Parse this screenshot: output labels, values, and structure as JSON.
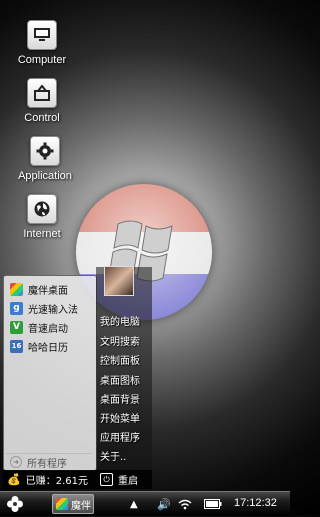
{
  "desktop": {
    "icons": [
      {
        "label": "Computer"
      },
      {
        "label": "Control"
      },
      {
        "label": "Application"
      },
      {
        "label": "Internet"
      }
    ]
  },
  "start_menu": {
    "apps": [
      {
        "label": "魔伴桌面"
      },
      {
        "label": "光速输入法"
      },
      {
        "label": "音速启动"
      },
      {
        "label": "哈哈日历"
      }
    ],
    "all_programs": "所有程序",
    "right_items": [
      "我的电脑",
      "文明搜索",
      "控制面板",
      "桌面图标",
      "桌面背景",
      "开始菜单",
      "应用程序",
      "关于.."
    ],
    "earned": "已赚：2.61元",
    "restart": "重启"
  },
  "taskbar": {
    "task_label": "魔伴",
    "clock": "17:12:32"
  }
}
